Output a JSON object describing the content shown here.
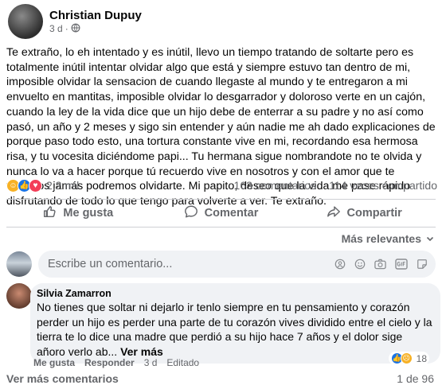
{
  "post": {
    "author": "Christian Dupuy",
    "time": "3 d",
    "privacy_icon": "globe-icon",
    "text": "Te extraño, lo eh intentado y es inútil, llevo un tiempo tratando de soltarte pero es totalmente inútil intentar olvidar algo que está y siempre estuvo tan dentro de mi, imposible olvidar la sensacion de cuando llegaste al mundo y te entregaron a mi envuelto en mantitas, imposible olvidar lo desgarrador y doloroso verte en un cajón, cuando la ley de la vida dice que un hijo debe de enterrar a su padre y no así como pasó, un año  y 2 meses y sigo sin entender y aún nadie me ah dado explicaciones de porque paso todo esto, una tortura constante vive en mi, recordando esa hermosa risa, y tu vocesita diciéndome papi... Tu hermana sigue nombrandote no te olvida y nunca lo va a hacer porque tú recuerdo vive en nosotros y con el amor que te tenemos jamás podremos olvidarte. Mi papito, deseo que la vida me pase rápido disfrutando de todo lo que tengo para volverte a ver. Te extraño.",
    "reaction_count": "2,2 mil",
    "comments_count": "163 comentarios",
    "shares_count": "114 veces compartido"
  },
  "actions": {
    "like": "Me gusta",
    "comment": "Comentar",
    "share": "Compartir"
  },
  "sort": {
    "label": "Más relevantes"
  },
  "composer": {
    "placeholder": "Escribe un comentario..."
  },
  "comment": {
    "author": "Silvia Zamarron",
    "text": "No tienes que soltar ni dejarlo ir tenlo siempre en tu pensamiento y corazón perder un hijo es perder una parte de tu corazón vives dividido entre el cielo y la tierra te lo dice una madre que perdió a su hijo hace 7 años y el dolor sige añoro verlo ab...",
    "see_more": "Ver más",
    "reaction_count": "18",
    "like": "Me gusta",
    "reply": "Responder",
    "time": "3 d",
    "edited": "Editado"
  },
  "footer": {
    "more_comments": "Ver más comentarios",
    "pager": "1 de 96"
  },
  "colors": {
    "like_blue": "#1b74e4",
    "love_red": "#f33e58",
    "care_yellow": "#f7b125",
    "secondary_text": "#65676b"
  }
}
